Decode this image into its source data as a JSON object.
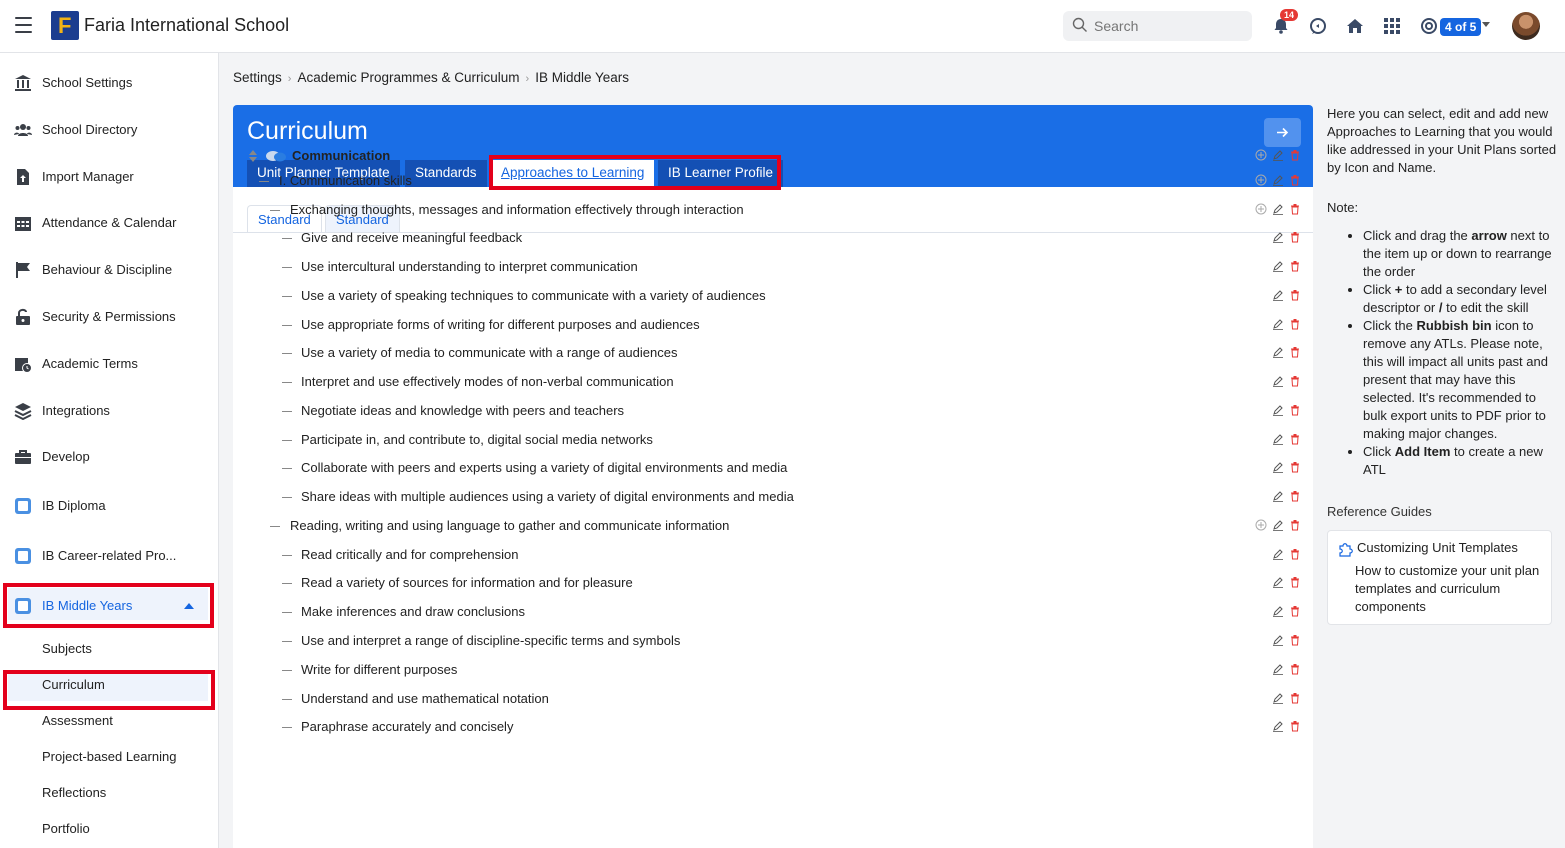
{
  "header": {
    "school_name": "Faria International School",
    "logo_letter": "F",
    "search_placeholder": "Search",
    "notification_count": "14",
    "pager": "4 of 5"
  },
  "sidebar": {
    "items": [
      {
        "label": "School Settings",
        "icon": "bank-icon"
      },
      {
        "label": "School Directory",
        "icon": "users-icon"
      },
      {
        "label": "Import Manager",
        "icon": "file-import-icon"
      },
      {
        "label": "Attendance & Calendar",
        "icon": "calendar-icon"
      },
      {
        "label": "Behaviour & Discipline",
        "icon": "flag-icon"
      },
      {
        "label": "Security & Permissions",
        "icon": "lock-icon"
      },
      {
        "label": "Academic Terms",
        "icon": "calendar-clock-icon"
      },
      {
        "label": "Integrations",
        "icon": "layers-icon"
      },
      {
        "label": "Develop",
        "icon": "briefcase-icon"
      },
      {
        "label": "IB Diploma",
        "icon": "ib-dp-icon"
      },
      {
        "label": "IB Career-related Pro...",
        "icon": "ib-cp-icon"
      },
      {
        "label": "IB Middle Years",
        "icon": "ib-myp-icon"
      }
    ],
    "subitems": [
      "Subjects",
      "Curriculum",
      "Assessment",
      "Project-based Learning",
      "Reflections",
      "Portfolio"
    ]
  },
  "breadcrumb": [
    "Settings",
    "Academic Programmes & Curriculum",
    "IB Middle Years"
  ],
  "card": {
    "title": "Curriculum",
    "tabs": [
      "Unit Planner Template",
      "Standards",
      "Approaches to Learning",
      "IB Learner Profile"
    ],
    "subtabs": [
      "Standard",
      "Standard"
    ]
  },
  "rows": [
    {
      "level": 0,
      "text": "Communication",
      "add": true
    },
    {
      "level": 1,
      "text": "I. Communication skills",
      "add": true
    },
    {
      "level": 2,
      "text": "Exchanging thoughts, messages and information effectively through interaction",
      "add": true
    },
    {
      "level": 3,
      "text": "Give and receive meaningful feedback",
      "add": false
    },
    {
      "level": 3,
      "text": "Use intercultural understanding to interpret communication",
      "add": false
    },
    {
      "level": 3,
      "text": "Use a variety of speaking techniques to communicate with a variety of audiences",
      "add": false
    },
    {
      "level": 3,
      "text": "Use appropriate forms of writing for different purposes and audiences",
      "add": false
    },
    {
      "level": 3,
      "text": "Use a variety of media to communicate with a range of audiences",
      "add": false
    },
    {
      "level": 3,
      "text": "Interpret and use effectively modes of non-verbal communication",
      "add": false
    },
    {
      "level": 3,
      "text": "Negotiate ideas and knowledge with peers and teachers",
      "add": false
    },
    {
      "level": 3,
      "text": "Participate in, and contribute to, digital social media networks",
      "add": false
    },
    {
      "level": 3,
      "text": "Collaborate with peers and experts using a variety of digital environments and media",
      "add": false
    },
    {
      "level": 3,
      "text": "Share ideas with multiple audiences using a variety of digital environments and media",
      "add": false
    },
    {
      "level": 2,
      "text": "Reading, writing and using language to gather and communicate information",
      "add": true
    },
    {
      "level": 3,
      "text": "Read critically and for comprehension",
      "add": false
    },
    {
      "level": 3,
      "text": "Read a variety of sources for information and for pleasure",
      "add": false
    },
    {
      "level": 3,
      "text": "Make inferences and draw conclusions",
      "add": false
    },
    {
      "level": 3,
      "text": "Use and interpret a range of discipline-specific terms and symbols",
      "add": false
    },
    {
      "level": 3,
      "text": "Write for different purposes",
      "add": false
    },
    {
      "level": 3,
      "text": "Understand and use mathematical notation",
      "add": false
    },
    {
      "level": 3,
      "text": "Paraphrase accurately and concisely",
      "add": false
    }
  ],
  "help": {
    "intro": "Here you can select, edit and add new Approaches to Learning that you would like addressed in your Unit Plans sorted by Icon and Name.",
    "note_label": "Note:",
    "b1_pre": "Click and drag the ",
    "b1_bold": "arrow",
    "b1_post": " next to the item up or down to rearrange the order",
    "b2_pre": "Click ",
    "b2_bold1": "+",
    "b2_mid": " to add a secondary level descriptor or ",
    "b2_bold2": "/",
    "b2_post": " to edit the skill",
    "b3_pre": "Click the ",
    "b3_bold": "Rubbish bin",
    "b3_post": " icon to remove any ATLs. Please note, this will impact all units past and present that may have this selected. It's recommended to bulk export units to PDF prior to making major changes.",
    "b4_pre": "Click ",
    "b4_bold": "Add Item",
    "b4_post": " to create a new ATL"
  },
  "reference": {
    "title": "Reference Guides",
    "card_title": "Customizing Unit Templates",
    "card_desc": "How to customize your unit plan templates and curriculum components"
  },
  "colors": {
    "brand_blue": "#1a6ee6",
    "highlight_red": "#e3001b",
    "delete_red": "#e53935"
  }
}
